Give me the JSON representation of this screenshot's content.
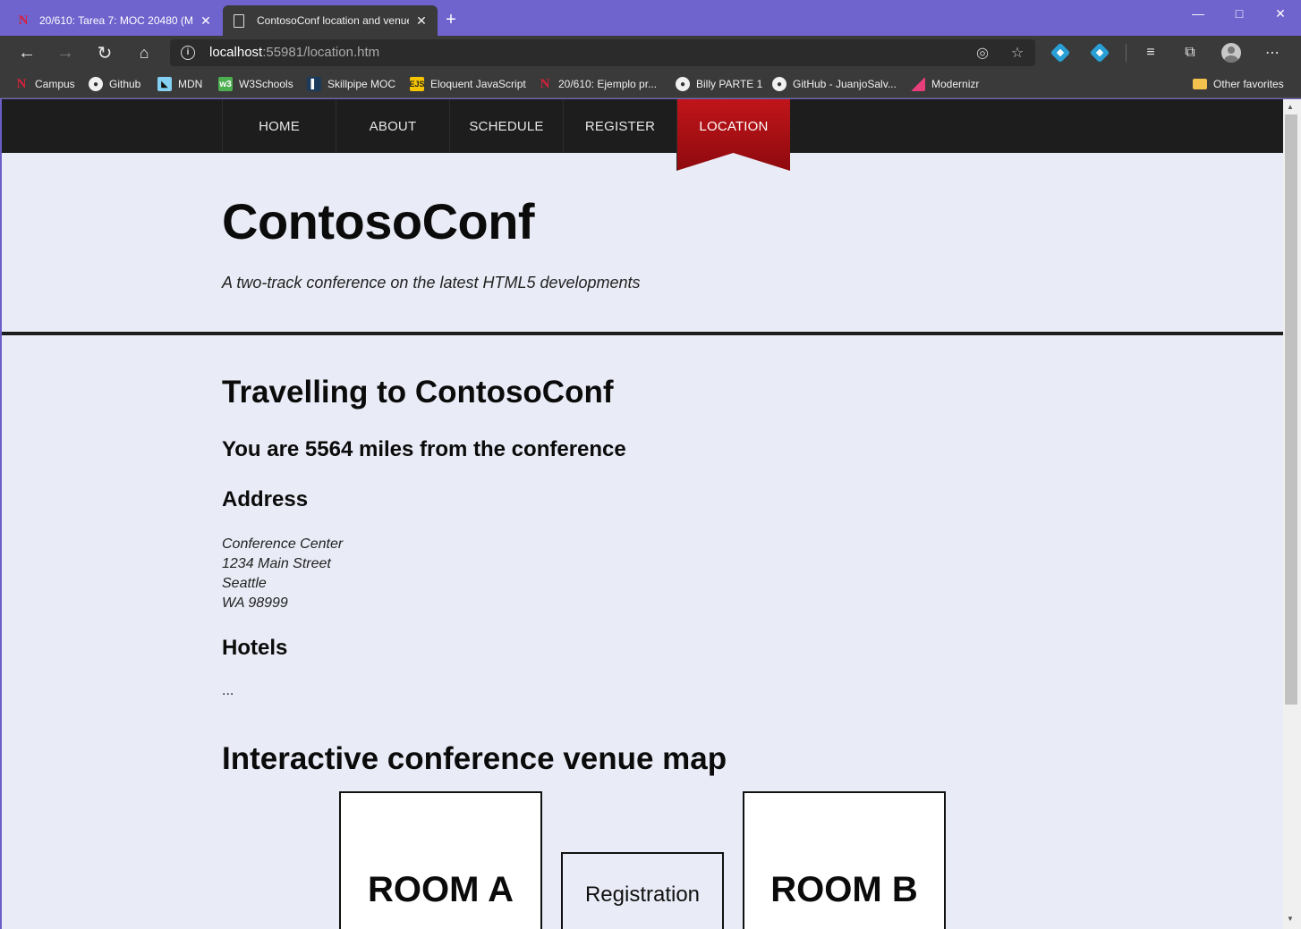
{
  "browser": {
    "tabs": [
      {
        "title": "20/610: Tarea 7: MOC 20480 (Mó",
        "icon": "n-favicon",
        "active": false
      },
      {
        "title": "ContosoConf location and venue",
        "icon": "page-icon",
        "active": true
      }
    ],
    "new_tab_label": "+",
    "url_host": "localhost",
    "url_rest": ":55981/location.htm",
    "bookmarks": [
      {
        "label": "Campus",
        "icon": "N"
      },
      {
        "label": "Github",
        "icon": "github"
      },
      {
        "label": "MDN",
        "icon": "mdn"
      },
      {
        "label": "W3Schools",
        "icon": "w3"
      },
      {
        "label": "Skillpipe MOC",
        "icon": "skillpipe"
      },
      {
        "label": "Eloquent JavaScript",
        "icon": "EJS"
      },
      {
        "label": "20/610: Ejemplo pr...",
        "icon": "N"
      },
      {
        "label": "Billy PARTE 1",
        "icon": "github"
      },
      {
        "label": "GitHub - JuanjoSalv...",
        "icon": "github"
      },
      {
        "label": "Modernizr",
        "icon": "modernizr"
      }
    ],
    "other_favorites": "Other favorites"
  },
  "site": {
    "nav": [
      "HOME",
      "ABOUT",
      "SCHEDULE",
      "REGISTER",
      "LOCATION"
    ],
    "active_nav": "LOCATION",
    "title": "ContosoConf",
    "subtitle": "A two-track conference on the latest HTML5 developments"
  },
  "content": {
    "travel_heading": "Travelling to ContosoConf",
    "distance_text": "You are 5564 miles from the conference",
    "address_heading": "Address",
    "address_lines": [
      "Conference Center",
      "1234 Main Street",
      "Seattle",
      "WA 98999"
    ],
    "hotels_heading": "Hotels",
    "hotels_text": "...",
    "map_heading": "Interactive conference venue map",
    "rooms": {
      "room_a": "ROOM A",
      "registration": "Registration",
      "room_b": "ROOM B"
    }
  }
}
